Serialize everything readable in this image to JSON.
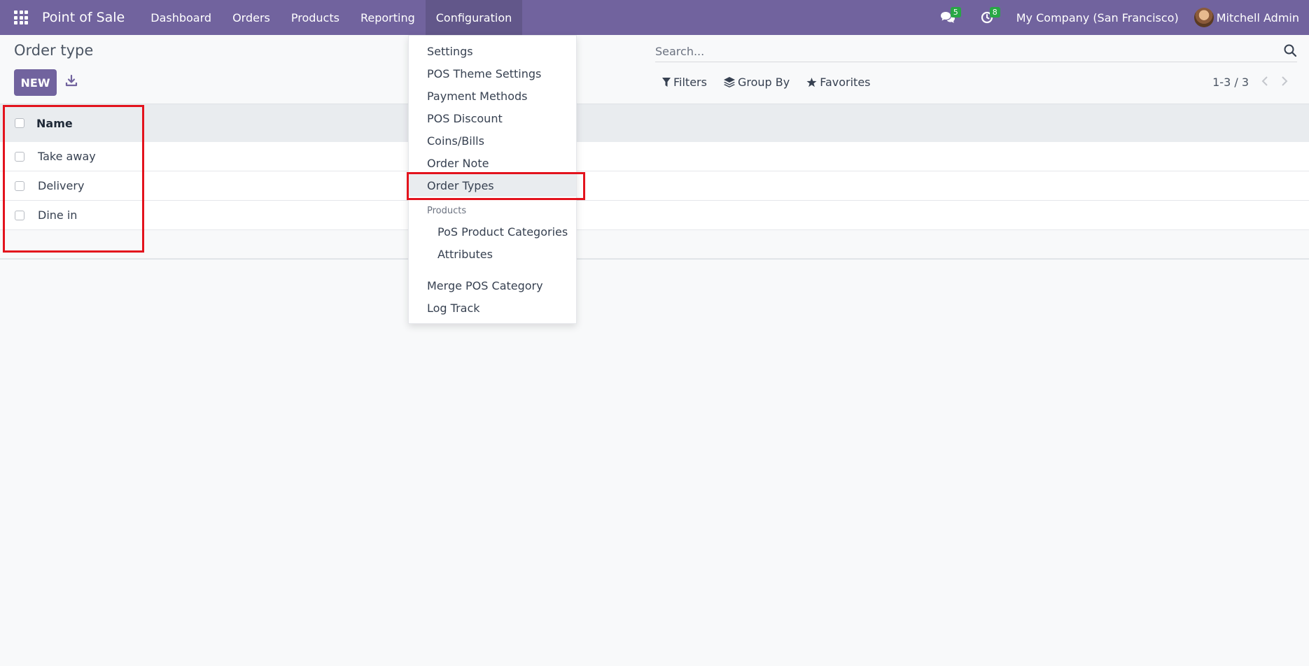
{
  "navbar": {
    "app_name": "Point of Sale",
    "menu": [
      "Dashboard",
      "Orders",
      "Products",
      "Reporting",
      "Configuration"
    ],
    "messages_count": "5",
    "activities_count": "8",
    "company": "My Company (San Francisco)",
    "user": "Mitchell Admin"
  },
  "control_panel": {
    "breadcrumb": "Order type",
    "new_label": "NEW",
    "search_placeholder": "Search...",
    "filters_label": "Filters",
    "group_by_label": "Group By",
    "favorites_label": "Favorites",
    "pager": "1-3 / 3"
  },
  "list": {
    "header": "Name",
    "rows": [
      "Take away",
      "Delivery",
      "Dine in"
    ]
  },
  "config_menu": {
    "items": [
      "Settings",
      "POS Theme Settings",
      "Payment Methods",
      "POS Discount",
      "Coins/Bills",
      "Order Note",
      "Order Types"
    ],
    "active_item": "Order Types",
    "section": "Products",
    "sub_items": [
      "PoS Product Categories",
      "Attributes"
    ],
    "bottom_items": [
      "Merge POS Category",
      "Log Track"
    ]
  },
  "colors": {
    "brand": "#71639e",
    "highlight": "#e3131d",
    "badge": "#28a745"
  }
}
